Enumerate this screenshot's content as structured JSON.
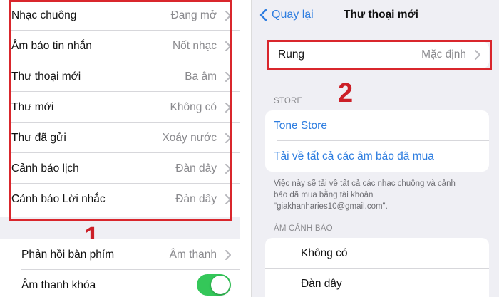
{
  "left": {
    "group1": [
      {
        "label": "Nhạc chuông",
        "value": "Đang mở"
      },
      {
        "label": "Âm báo tin nhắn",
        "value": "Nốt nhạc"
      },
      {
        "label": "Thư thoại mới",
        "value": "Ba âm"
      },
      {
        "label": "Thư mới",
        "value": "Không có"
      },
      {
        "label": "Thư đã gửi",
        "value": "Xoáy nước"
      },
      {
        "label": "Cảnh báo lịch",
        "value": "Đàn dây"
      },
      {
        "label": "Cảnh báo Lời nhắc",
        "value": "Đàn dây"
      }
    ],
    "callout_number": "1",
    "group2": {
      "keyboard_feedback": {
        "label": "Phản hồi bàn phím",
        "value": "Âm thanh"
      },
      "lock_sound": {
        "label": "Âm thanh khóa",
        "toggle_on": true
      }
    }
  },
  "right": {
    "nav": {
      "back_label": "Quay lại",
      "title": "Thư thoại mới"
    },
    "vibration": {
      "label": "Rung",
      "value": "Mặc định"
    },
    "callout_number": "2",
    "store": {
      "section_title": "STORE",
      "tone_store": "Tone Store",
      "download_all": "Tải về tất cả các âm báo đã mua",
      "footnote_line1": "Việc này sẽ tải về tất cả các nhạc chuông và cảnh",
      "footnote_line2": "báo đã mua bằng tài khoản",
      "footnote_line3": "\"giakhanharies10@gmail.com\"."
    },
    "alert_tones": {
      "section_title": "ÂM CẢNH BÁO",
      "items": [
        "Không có",
        "Đàn dây"
      ]
    }
  },
  "colors": {
    "accent_blue": "#2d7de0",
    "highlight_red": "#d9262c",
    "toggle_green": "#34c759",
    "background": "#efeff4"
  },
  "icons": {
    "chevron": "chevron-right-icon",
    "back": "chevron-left-icon"
  }
}
